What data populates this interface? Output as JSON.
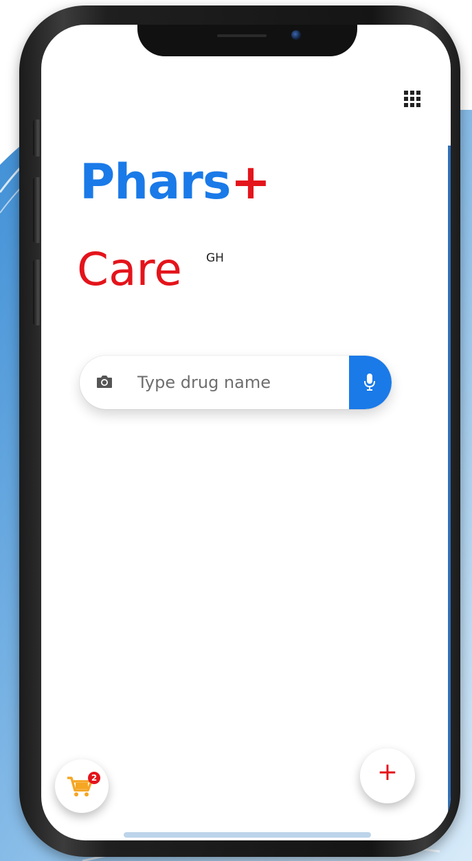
{
  "app": {
    "logo_word1": "Phars",
    "logo_plus": "+",
    "logo_word2": "Care",
    "logo_superscript": "GH"
  },
  "header": {
    "menu_icon": "grid-icon"
  },
  "search": {
    "placeholder": "Type drug name",
    "value": "",
    "left_icon": "camera-icon",
    "right_icon": "microphone-icon"
  },
  "cart": {
    "icon": "shopping-cart-icon",
    "badge_count": "2"
  },
  "fab": {
    "label": "+",
    "icon": "add-icon"
  },
  "colors": {
    "brand_blue": "#1a7ae8",
    "brand_red": "#e4141b",
    "cart_orange": "#f5a623"
  }
}
